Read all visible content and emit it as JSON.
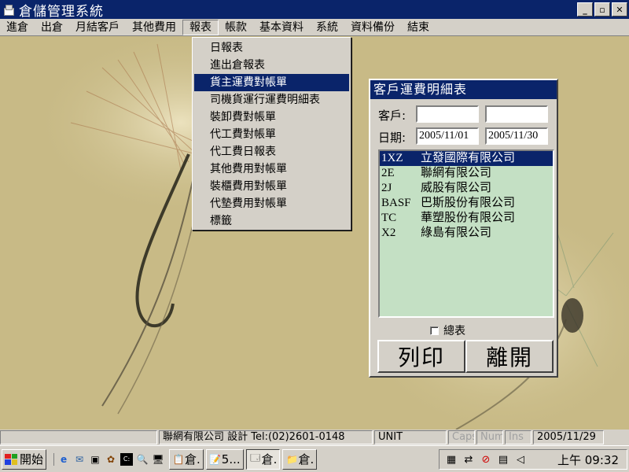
{
  "window": {
    "title": "倉儲管理系統",
    "controls": {
      "minimize": "_",
      "restore": "▫",
      "close": "✕"
    }
  },
  "menubar": {
    "items": [
      "進倉",
      "出倉",
      "月結客戶",
      "其他費用",
      "報表",
      "帳款",
      "基本資料",
      "系統",
      "資料備份",
      "結束"
    ],
    "active_index": 4
  },
  "report_menu": {
    "items": [
      "日報表",
      "進出倉報表",
      "貨主運費對帳單",
      "司機貨運行運費明細表",
      "裝卸費對帳單",
      "代工費對帳單",
      "代工費日報表",
      "其他費用對帳單",
      "裝櫃費用對帳單",
      "代墊費用對帳單",
      "標籤"
    ],
    "highlighted_index": 2
  },
  "dialog": {
    "title": "客戶運費明細表",
    "customer_label": "客戶:",
    "customer_from": "",
    "customer_to": "",
    "date_label": "日期:",
    "date_from": "2005/11/01",
    "date_to": "2005/11/30",
    "customers": [
      {
        "code": "1XZ",
        "name": "立發國際有限公司"
      },
      {
        "code": "2E",
        "name": "聯網有限公司"
      },
      {
        "code": "2J",
        "name": "威股有限公司"
      },
      {
        "code": "BASF",
        "name": "巴斯股份有限公司"
      },
      {
        "code": "TC",
        "name": "華塑股份有限公司"
      },
      {
        "code": "X2",
        "name": "綠島有限公司"
      }
    ],
    "selected_index": 0,
    "summary_label": "總表",
    "summary_checked": false,
    "print_button": "列印",
    "exit_button": "離開"
  },
  "statusbar": {
    "company": "聯網有限公司 設計 Tel:(02)2601-0148",
    "unit": "UNIT",
    "caps": "Caps",
    "num": "Num",
    "ins": "Ins",
    "date": "2005/11/29"
  },
  "taskbar": {
    "start_label": "開始",
    "tasks": [
      {
        "label": "倉.",
        "pressed": false
      },
      {
        "label": "5...",
        "pressed": false
      },
      {
        "label": "倉.",
        "pressed": true
      },
      {
        "label": "倉.",
        "pressed": false
      }
    ],
    "clock": "上午 09:32"
  },
  "colors": {
    "titlebar": "#0a246a",
    "desktop": "#c8ba86",
    "list_bg": "#c4e0c4",
    "chrome": "#d4d0c8"
  }
}
